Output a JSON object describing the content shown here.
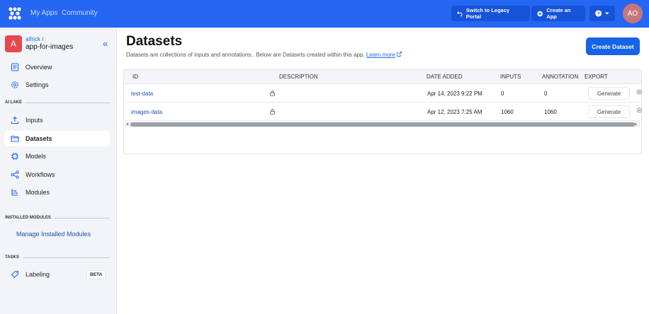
{
  "topbar": {
    "nav": [
      "My Apps",
      "Community"
    ],
    "legacy_btn": "Switch to Legacy Portal",
    "create_app_btn": "Create an App",
    "help_icon": "?",
    "avatar": "AO"
  },
  "sidebar": {
    "app_icon_letter": "A",
    "owner": "alfrick",
    "app_name": "app-for-images",
    "top_items": [
      {
        "label": "Overview",
        "icon": "overview-icon"
      },
      {
        "label": "Settings",
        "icon": "gear-icon"
      }
    ],
    "ai_lake_header": "AI LAKE",
    "ai_lake_items": [
      {
        "label": "Inputs",
        "icon": "upload-icon"
      },
      {
        "label": "Datasets",
        "icon": "folder-icon",
        "active": true
      },
      {
        "label": "Models",
        "icon": "chip-icon"
      },
      {
        "label": "Workflows",
        "icon": "share-icon"
      },
      {
        "label": "Modules",
        "icon": "modules-icon"
      }
    ],
    "installed_header": "INSTALLED MODULES",
    "manage_link": "Manage Installed Modules",
    "tasks_header": "TASKS",
    "labeling": {
      "label": "Labeling",
      "badge": "BETA"
    }
  },
  "main": {
    "title": "Datasets",
    "subtitle": "Datasets are collections of inputs and annotations.. Below are Datasets created within this app.",
    "learn_more": "Learn more",
    "create_btn": "Create Dataset",
    "table": {
      "headers": [
        "ID",
        "DESCRIPTION",
        "DATE ADDED",
        "INPUTS",
        "ANNOTATION",
        "EXPORT"
      ],
      "rows": [
        {
          "id": "test-data",
          "date": "Apr 14, 2023 9:22 PM",
          "inputs": "0",
          "annotation": "0",
          "export": "Generate"
        },
        {
          "id": "images-data",
          "date": "Apr 12, 2023 7:25 AM",
          "inputs": "1060",
          "annotation": "1060",
          "export": "Generate"
        }
      ]
    }
  },
  "colors": {
    "brand": "#2566f2",
    "avatar": "#c7767e",
    "app_icon": "#e5484d"
  }
}
